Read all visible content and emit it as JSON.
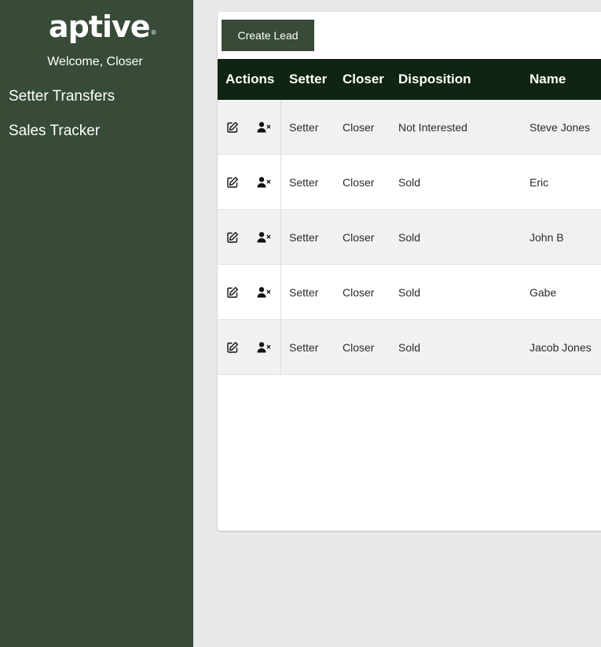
{
  "sidebar": {
    "logo_text": "aptive",
    "logo_mark": "®",
    "welcome": "Welcome, Closer",
    "nav": [
      {
        "label": "Setter Transfers"
      },
      {
        "label": "Sales Tracker"
      }
    ]
  },
  "toolbar": {
    "create_label": "Create Lead"
  },
  "table": {
    "headers": {
      "actions": "Actions",
      "setter": "Setter",
      "closer": "Closer",
      "disposition": "Disposition",
      "name": "Name"
    },
    "rows": [
      {
        "setter": "Setter",
        "closer": "Closer",
        "disposition": "Not Interested",
        "name": "Steve Jones"
      },
      {
        "setter": "Setter",
        "closer": "Closer",
        "disposition": "Sold",
        "name": "Eric"
      },
      {
        "setter": "Setter",
        "closer": "Closer",
        "disposition": "Sold",
        "name": "John B"
      },
      {
        "setter": "Setter",
        "closer": "Closer",
        "disposition": "Sold",
        "name": "Gabe"
      },
      {
        "setter": "Setter",
        "closer": "Closer",
        "disposition": "Sold",
        "name": "Jacob Jones"
      }
    ],
    "row_icons": [
      "edit-icon",
      "remove-user-icon"
    ]
  },
  "colors": {
    "sidebar": "#374b38",
    "header": "#0f2412",
    "button": "#374b38",
    "background": "#e8e8e8"
  }
}
